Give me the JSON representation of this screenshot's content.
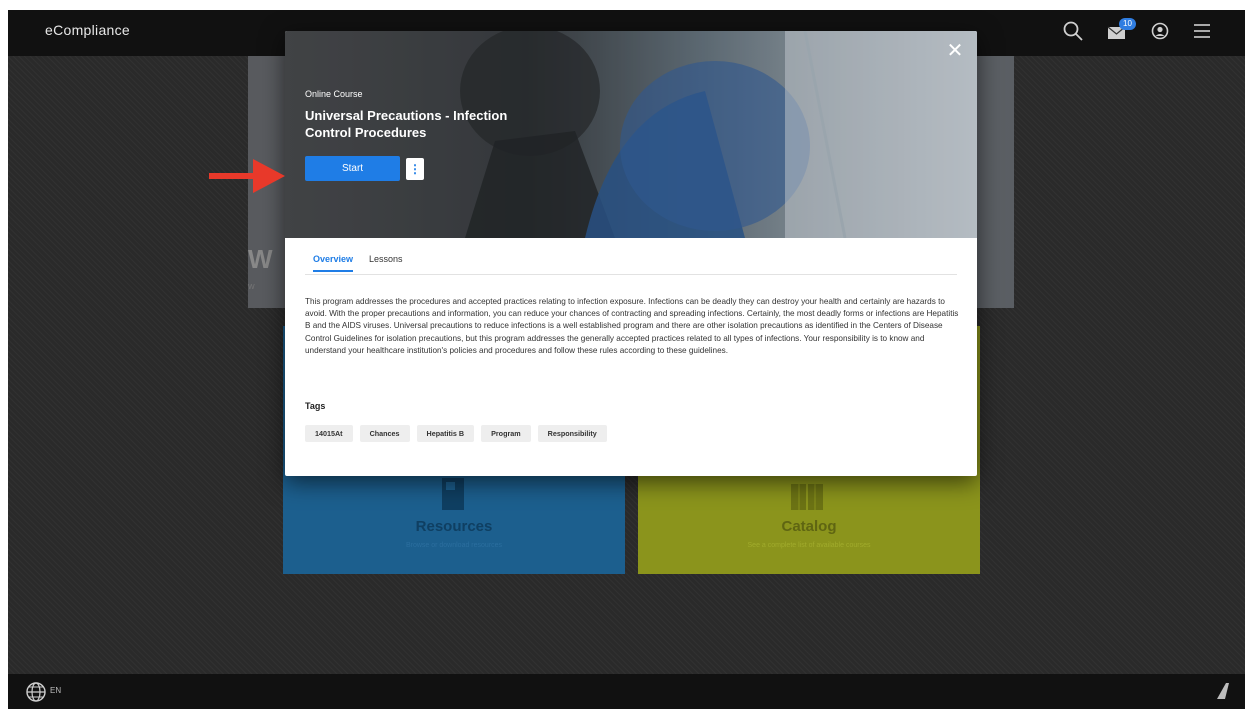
{
  "app": {
    "logo": "eCompliance"
  },
  "header": {
    "messages_count": "10"
  },
  "modal": {
    "course_type": "Online Course",
    "course_title": "Universal Precautions - Infection Control Procedures",
    "start_label": "Start",
    "more_label": "⋮",
    "close_label": "✕",
    "tabs": [
      {
        "label": "Overview",
        "active": true
      },
      {
        "label": "Lessons",
        "active": false
      }
    ],
    "overview_text": "This program addresses the procedures and accepted practices relating to infection exposure. Infections can be deadly they can destroy your health and certainly are hazards to avoid. With the proper precautions and information, you can reduce your chances of contracting and spreading infections. Certainly, the most deadly forms or infections are Hepatitis B and the AIDS viruses. Universal precautions to reduce infections is a well established program and there are other isolation precautions as identified in the Centers of Disease Control Guidelines for isolation precautions, but this program addresses the generally accepted practices related to all types of infections. Your responsibility is to know and understand your healthcare institution's policies and procedures and follow these rules according to these guidelines.",
    "tags_label": "Tags",
    "tags": [
      "14015At",
      "Chances",
      "Hepatitis B",
      "Program",
      "Responsibility"
    ]
  },
  "background": {
    "hero_letter": "W",
    "hero_small": "W",
    "tiles": [
      {
        "title": "Resources",
        "subtitle": "Browse or download resources",
        "color": "#1c5f8e"
      },
      {
        "title": "Catalog",
        "subtitle": "See a complete list of available courses",
        "color": "#8b941c"
      }
    ]
  },
  "footer": {
    "language": "EN"
  },
  "colors": {
    "accent": "#1f7de6",
    "topbar": "#111111",
    "badge": "#2f7de1",
    "arrow": "#e8392a"
  },
  "icons": [
    "search-icon",
    "mail-icon",
    "user-icon",
    "menu-icon",
    "close-icon",
    "more-icon",
    "globe-icon",
    "brand-icon",
    "arrow-icon"
  ]
}
